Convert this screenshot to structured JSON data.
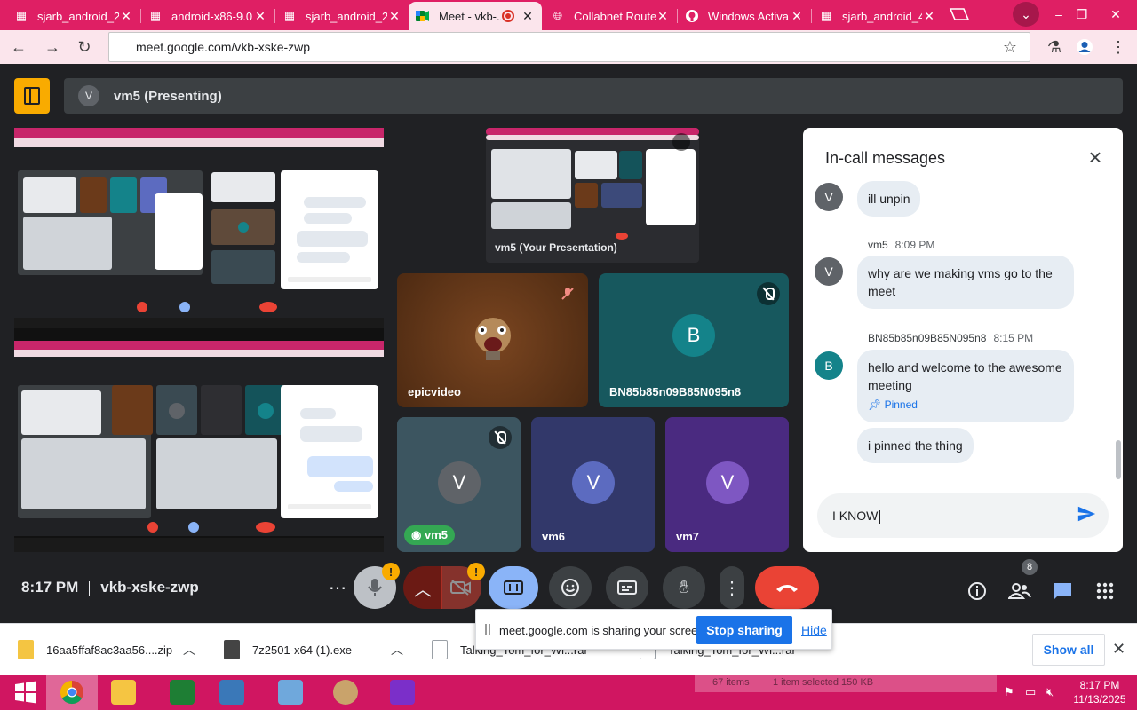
{
  "browser": {
    "tabs": [
      {
        "label": "sjarb_android_2...",
        "active": false
      },
      {
        "label": "android-x86-9.0...",
        "active": false
      },
      {
        "label": "sjarb_android_2...",
        "active": false
      },
      {
        "label": "Meet - vkb-...",
        "active": true
      },
      {
        "label": "Collabnet Route...",
        "active": false
      },
      {
        "label": "Windows Activa...",
        "active": false
      },
      {
        "label": "sjarb_android_4...",
        "active": false
      }
    ],
    "url": "meet.google.com/vkb-xske-zwp"
  },
  "meet": {
    "presenting_avatar": "V",
    "presenting_title": "vm5 (Presenting)",
    "participants": [
      {
        "name": "epicvideo",
        "initial": "",
        "color": "#6b3a1a"
      },
      {
        "name": "BN85b85n09B85N095n8",
        "initial": "B",
        "color": "#14838a"
      },
      {
        "name": "vm5",
        "initial": "V",
        "color": "#5f6368"
      },
      {
        "name": "vm6",
        "initial": "V",
        "color": "#5c6bc0"
      },
      {
        "name": "vm7",
        "initial": "V",
        "color": "#7e57c2"
      }
    ],
    "self_label": "vm5",
    "thumbnail_caption": "vm5 (Your Presentation)",
    "meeting_time": "8:17 PM",
    "meeting_code": "vkb-xske-zwp",
    "participant_count": "8"
  },
  "chat": {
    "title": "In-call messages",
    "messages": [
      {
        "sender": "",
        "time": "",
        "avatar": "V",
        "avatar_color": "#5f6368",
        "text": "ill unpin",
        "pinned": false
      },
      {
        "sender": "vm5",
        "time": "8:09 PM",
        "avatar": "V",
        "avatar_color": "#5f6368",
        "text": "why are we making vms go to the meet",
        "pinned": false
      },
      {
        "sender": "BN85b85n09B85N095n8",
        "time": "8:15 PM",
        "avatar": "B",
        "avatar_color": "#14838a",
        "text": "hello and welcome to the awesome meeting",
        "pinned": true,
        "pinned_label": "Pinned"
      },
      {
        "sender": "",
        "time": "",
        "avatar": "",
        "avatar_color": "",
        "text": "i pinned the thing",
        "pinned": false
      }
    ],
    "input_value": "I KNOW"
  },
  "sharebar": {
    "message": "meet.google.com is sharing your screen.",
    "stop_label": "Stop sharing",
    "hide_label": "Hide"
  },
  "downloads": {
    "items": [
      {
        "name": "16aa5ffaf8ac3aa56....zip",
        "icon_color": "#f4c542"
      },
      {
        "name": "7z2501-x64 (1).exe",
        "icon_color": "#444444"
      },
      {
        "name": "Talking_Tom_for_Wi...rar",
        "icon_color": "#ffffff"
      },
      {
        "name": "Talking_Tom_for_Wi...rar",
        "icon_color": "#ffffff"
      }
    ],
    "show_all_label": "Show all"
  },
  "taskbar": {
    "ghost_text_left": "67 items",
    "ghost_text_right": "1 item selected  150 KB",
    "time": "8:17 PM",
    "date": "11/13/2025"
  },
  "colors": {
    "accent_pink": "#df1f64",
    "meet_bg": "#202124",
    "leave_red": "#ea4335",
    "present_blue": "#8ab4f8",
    "warn_yellow": "#f9ab00"
  }
}
